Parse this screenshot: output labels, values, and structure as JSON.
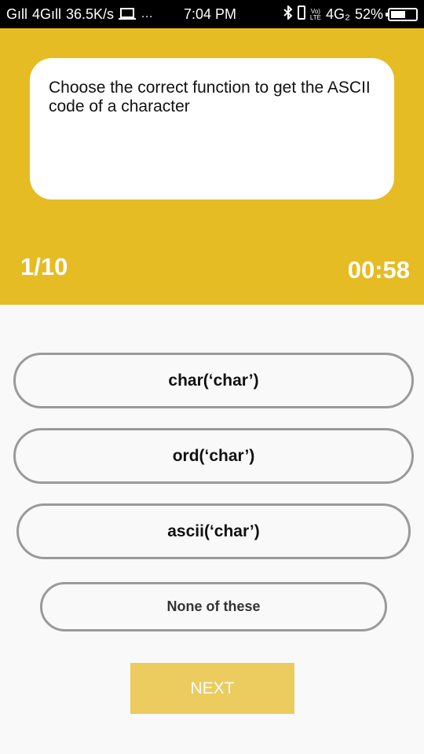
{
  "status_bar": {
    "signal1": "Gıll",
    "network": "4Gıll",
    "speed": "36.5K/s",
    "laptop_icon": "laptop-icon",
    "more_icon": "…",
    "time": "7:04 PM",
    "volte_top": "Vo)",
    "volte_bottom": "LTE",
    "network_right": "4G₂",
    "battery": "52%"
  },
  "quiz": {
    "question": "Choose the correct function to get the ASCII code of a character",
    "counter": "1/10",
    "timer": "00:58",
    "options": [
      {
        "label": "char(‘char’)"
      },
      {
        "label": "ord(‘char’)"
      },
      {
        "label": "ascii(‘char’)"
      },
      {
        "label": "None of these"
      }
    ],
    "next_label": "NEXT"
  },
  "colors": {
    "accent": "#e5bc24",
    "next_button": "#eccb5f",
    "option_border": "#9a9a9a",
    "background": "#f9f9f9"
  }
}
